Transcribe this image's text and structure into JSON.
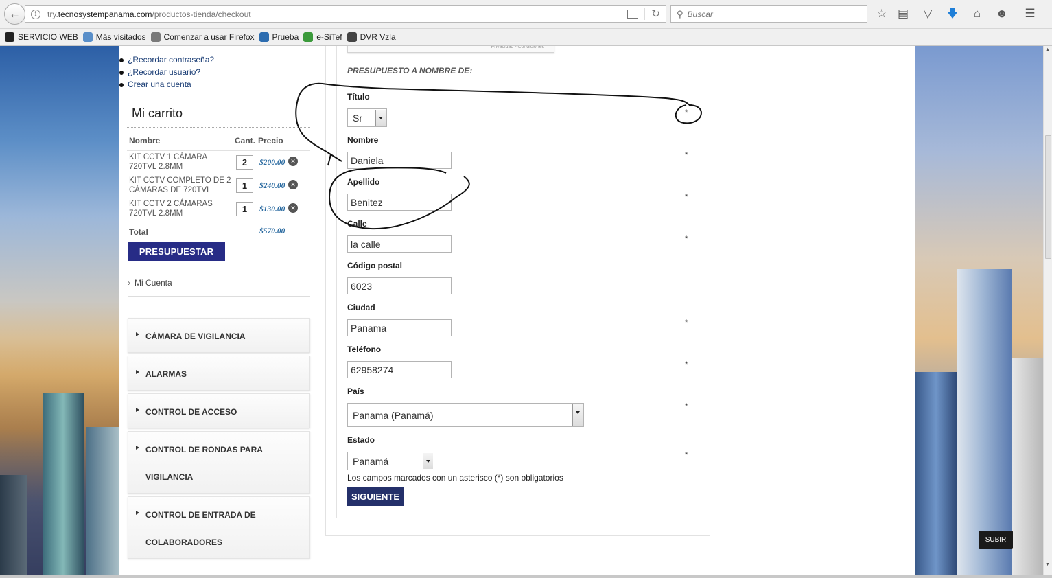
{
  "browser": {
    "url_prefix": "try.",
    "url_domain": "tecnosystempanama.com",
    "url_path": "/productos-tienda/checkout",
    "search_placeholder": "Buscar",
    "bookmarks": [
      {
        "label": "SERVICIO WEB",
        "icon": "web-service-icon",
        "color": "#222"
      },
      {
        "label": "Más visitados",
        "icon": "most-visited-icon",
        "color": "#5a8fc9"
      },
      {
        "label": "Comenzar a usar Firefox",
        "icon": "firefox-icon",
        "color": "#7a7a7a"
      },
      {
        "label": "Prueba",
        "icon": "prueba-icon",
        "color": "#2d6db0"
      },
      {
        "label": "e-SiTef",
        "icon": "esitef-icon",
        "color": "#3b9a3b"
      },
      {
        "label": "DVR Vzla",
        "icon": "dvr-icon",
        "color": "#444"
      }
    ]
  },
  "sidebar": {
    "links": [
      "¿Recordar contraseña?",
      "¿Recordar usuario?",
      "Crear una cuenta"
    ],
    "cart": {
      "title": "Mi carrito",
      "headers": {
        "name": "Nombre",
        "qty": "Cant.",
        "price": "Precio"
      },
      "items": [
        {
          "name": "KIT CCTV 1 CÁMARA 720TVL 2.8MM",
          "qty": "2",
          "price": "$200.00"
        },
        {
          "name": "KIT CCTV COMPLETO DE 2 CÁMARAS DE 720TVL",
          "qty": "1",
          "price": "$240.00"
        },
        {
          "name": "KIT CCTV 2 CÁMARAS 720TVL 2.8MM",
          "qty": "1",
          "price": "$130.00"
        }
      ],
      "total_label": "Total",
      "total_value": "$570.00",
      "button": "PRESUPUESTAR"
    },
    "account": "Mi Cuenta",
    "categories": [
      "CÁMARA DE VIGILANCIA",
      "ALARMAS",
      "CONTROL DE ACCESO",
      "CONTROL DE RONDAS PARA VIGILANCIA",
      "CONTROL DE ENTRADA DE COLABORADORES"
    ]
  },
  "form": {
    "recaptcha_text": "Privacidad - Condiciones",
    "section_title": "PRESUPUESTO A NOMBRE DE:",
    "titulo_label": "Título",
    "titulo_value": "Sr",
    "nombre_label": "Nombre",
    "nombre_value": "Daniela",
    "apellido_label": "Apellido",
    "apellido_value": "Benitez",
    "calle_label": "Calle",
    "calle_value": "la calle",
    "cp_label": "Código postal",
    "cp_value": "6023",
    "ciudad_label": "Ciudad",
    "ciudad_value": "Panama",
    "telefono_label": "Teléfono",
    "telefono_value": "62958274",
    "pais_label": "País",
    "pais_value": "Panama (Panamá)",
    "estado_label": "Estado",
    "estado_value": "Panamá",
    "required_mark": "*",
    "required_note": "Los campos marcados con un asterisco (*) son obligatorios",
    "next_button": "SIGUIENTE"
  },
  "scroll_top": "SUBIR"
}
